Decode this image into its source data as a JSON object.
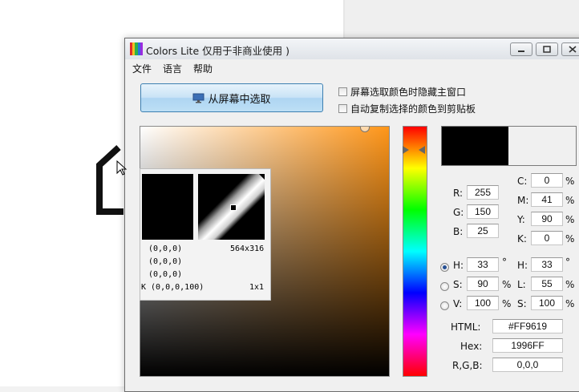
{
  "window": {
    "title": "Colors Lite 仅用于非商业使用 )",
    "menu": [
      "文件",
      "语言",
      "帮助"
    ]
  },
  "pick": {
    "button_label": "从屏幕中选取",
    "option_hide": "屏幕选取颜色时隐藏主窗口",
    "option_copy": "自动复制选择的颜色到剪贴板"
  },
  "loupe": {
    "size": "564x316",
    "line1": "(0,0,0)",
    "line2": "(0,0,0)",
    "line3": "(0,0,0)",
    "line4": "K (0,0,0,100)",
    "zoom": "1x1"
  },
  "rgb": {
    "r_label": "R:",
    "r": "255",
    "g_label": "G:",
    "g": "150",
    "b_label": "B:",
    "b": "25"
  },
  "cmyk": {
    "c_label": "C:",
    "c": "0",
    "m_label": "M:",
    "m": "41",
    "y_label": "Y:",
    "y": "90",
    "k_label": "K:",
    "k": "0",
    "unit": "%"
  },
  "hsv": {
    "h_label": "H:",
    "h": "33",
    "h_unit": "°",
    "s_label": "S:",
    "s": "90",
    "s_unit": "%",
    "v_label": "V:",
    "v": "100",
    "v_unit": "%"
  },
  "hsl": {
    "h_label": "H:",
    "h": "33",
    "h_unit": "°",
    "l_label": "L:",
    "l": "55",
    "l_unit": "%",
    "s_label": "S:",
    "s": "100",
    "s_unit": "%"
  },
  "codes": {
    "html_label": "HTML:",
    "html": "#FF9619",
    "hex_label": "Hex:",
    "hex": "1996FF",
    "rgb_label": "R,G,B:",
    "rgb": "0,0,0"
  },
  "colors": {
    "selected": "#FF9619",
    "preview_new": "#000000",
    "preview_old": "#F0F0F0"
  }
}
